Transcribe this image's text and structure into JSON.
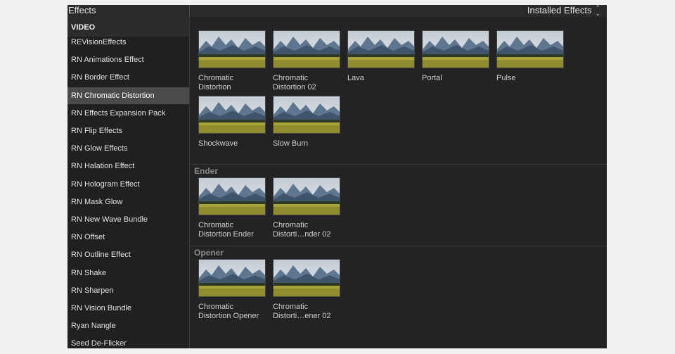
{
  "window": {
    "title": "Effects",
    "filter_label": "Installed Effects",
    "filter_icon": "updown-chevron-icon"
  },
  "sidebar": {
    "section": "VIDEO",
    "items": [
      {
        "label": "REVisionEffects",
        "selected": false
      },
      {
        "label": "RN Animations Effect",
        "selected": false
      },
      {
        "label": "RN Border Effect",
        "selected": false
      },
      {
        "label": "RN Chromatic Distortion",
        "selected": true
      },
      {
        "label": "RN Effects Expansion Pack",
        "selected": false
      },
      {
        "label": "RN Flip Effects",
        "selected": false
      },
      {
        "label": "RN Glow Effects",
        "selected": false
      },
      {
        "label": "RN Halation Effect",
        "selected": false
      },
      {
        "label": "RN Hologram Effect",
        "selected": false
      },
      {
        "label": "RN Mask Glow",
        "selected": false
      },
      {
        "label": "RN New Wave Bundle",
        "selected": false
      },
      {
        "label": "RN Offset",
        "selected": false
      },
      {
        "label": "RN Outline Effect",
        "selected": false
      },
      {
        "label": "RN Shake",
        "selected": false
      },
      {
        "label": "RN Sharpen",
        "selected": false
      },
      {
        "label": "RN Vision Bundle",
        "selected": false
      },
      {
        "label": "Ryan Nangle",
        "selected": false
      },
      {
        "label": "Seed De-Flicker",
        "selected": false
      }
    ]
  },
  "groups": [
    {
      "heading": "",
      "effects": [
        {
          "name": "Chromatic Distortion"
        },
        {
          "name": "Chromatic Distortion 02"
        },
        {
          "name": "Lava"
        },
        {
          "name": "Portal"
        },
        {
          "name": "Pulse"
        },
        {
          "name": "Shockwave"
        },
        {
          "name": "Slow Burn"
        }
      ]
    },
    {
      "heading": "Ender",
      "effects": [
        {
          "name": "Chromatic Distortion Ender"
        },
        {
          "name": "Chromatic Distorti…nder 02"
        }
      ]
    },
    {
      "heading": "Opener",
      "effects": [
        {
          "name": "Chromatic Distortion Opener"
        },
        {
          "name": "Chromatic Distorti…ener 02"
        }
      ]
    }
  ],
  "colors": {
    "background": "#232325",
    "selected_row": "#4a4a4c",
    "text": "#e2e2e2"
  }
}
